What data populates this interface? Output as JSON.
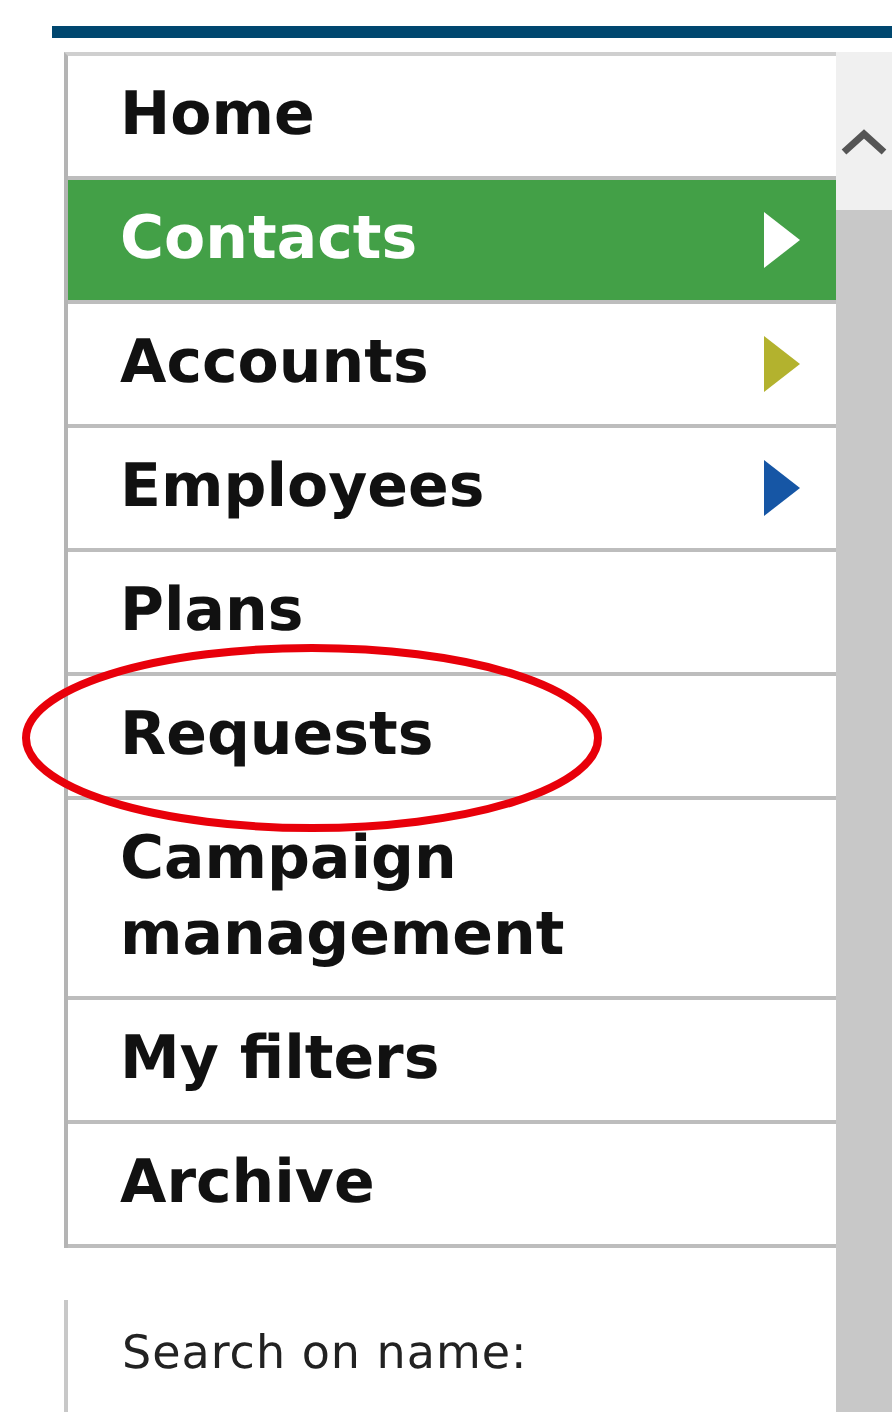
{
  "menu": {
    "items": [
      {
        "label": "Home",
        "selected": false,
        "arrow": false,
        "circled": false
      },
      {
        "label": "Contacts",
        "selected": true,
        "arrow": true,
        "color": "#ffffff",
        "circled": false
      },
      {
        "label": "Accounts",
        "selected": false,
        "arrow": true,
        "color": "#b3b22e",
        "circled": false
      },
      {
        "label": "Employees",
        "selected": false,
        "arrow": true,
        "color": "#1656a5",
        "circled": false
      },
      {
        "label": "Plans",
        "selected": false,
        "arrow": false,
        "circled": false
      },
      {
        "label": "Requests",
        "selected": false,
        "arrow": false,
        "circled": true
      },
      {
        "label": "Campaign management",
        "selected": false,
        "arrow": false,
        "circled": false
      },
      {
        "label": "My filters",
        "selected": false,
        "arrow": false,
        "circled": false
      },
      {
        "label": "Archive",
        "selected": false,
        "arrow": false,
        "circled": false
      }
    ]
  },
  "search": {
    "label": "Search on name:"
  }
}
